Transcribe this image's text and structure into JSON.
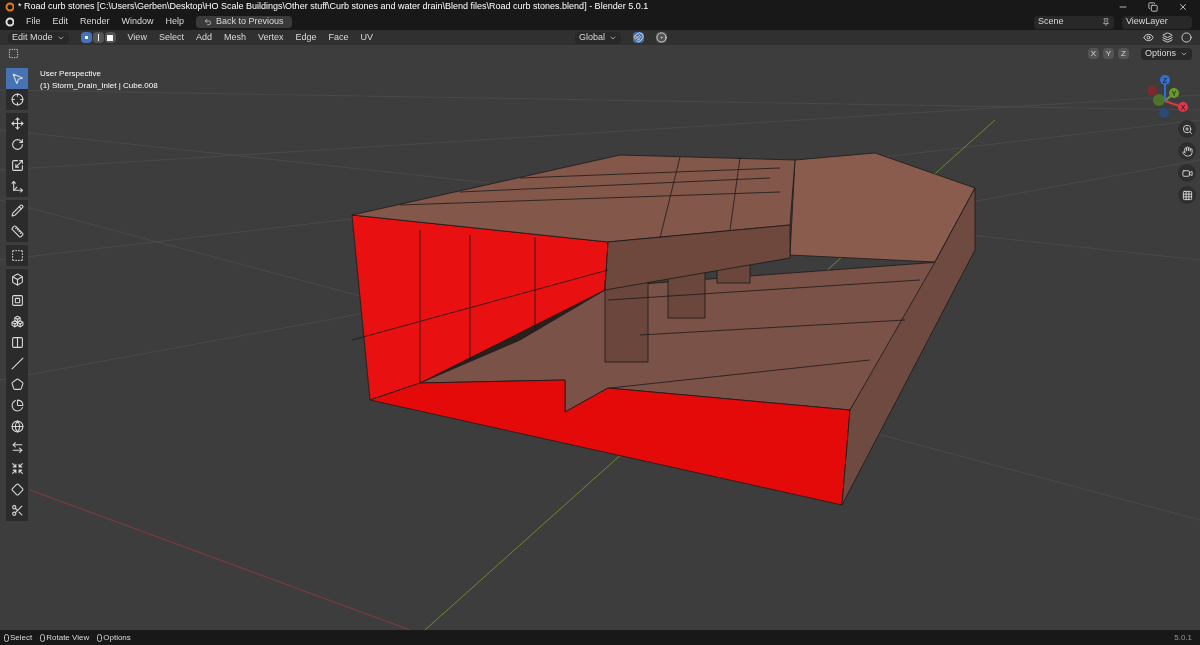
{
  "window": {
    "title": "* Road curb stones [C:\\Users\\Gerben\\Desktop\\HO Scale Buildings\\Other stuff\\Curb stones and water drain\\Blend files\\Road curb stones.blend] - Blender 5.0.1"
  },
  "menu_bar": {
    "items": [
      "File",
      "Edit",
      "Render",
      "Window",
      "Help"
    ],
    "back_button": "Back to Previous",
    "scene": "Scene",
    "view_layer": "ViewLayer"
  },
  "header": {
    "mode": "Edit Mode",
    "select_modes": [
      {
        "kind": "vertex",
        "selected": true
      },
      {
        "kind": "edge",
        "selected": false
      },
      {
        "kind": "face",
        "selected": false
      }
    ],
    "menus": [
      "View",
      "Select",
      "Add",
      "Mesh",
      "Vertex",
      "Edge",
      "Face",
      "UV"
    ],
    "orientation": "Global",
    "snap": {
      "on": true
    },
    "proportional": {
      "on": false
    }
  },
  "tool_settings": {
    "axes": [
      "X",
      "Y",
      "Z"
    ],
    "options": "Options"
  },
  "viewport": {
    "view_name": "User Perspective",
    "object_info": "(1) Storm_Drain_Inlet | Cube.008",
    "tool_groups": [
      [
        {
          "kind": "select",
          "selected": true
        },
        {
          "kind": "cursor",
          "selected": false
        }
      ],
      [
        {
          "kind": "move",
          "selected": false
        },
        {
          "kind": "rotate",
          "selected": false
        },
        {
          "kind": "scale",
          "selected": false
        },
        {
          "kind": "transform",
          "selected": false
        }
      ],
      [
        {
          "kind": "annotate",
          "selected": false
        },
        {
          "kind": "measure",
          "selected": false
        }
      ],
      [
        {
          "kind": "add",
          "selected": false
        }
      ],
      [
        {
          "kind": "extrude",
          "selected": false
        },
        {
          "kind": "inset",
          "selected": false
        },
        {
          "kind": "bevel",
          "selected": false
        },
        {
          "kind": "loop",
          "selected": false
        },
        {
          "kind": "knife",
          "selected": false
        },
        {
          "kind": "poly",
          "selected": false
        },
        {
          "kind": "spin",
          "selected": false
        },
        {
          "kind": "smooth",
          "selected": false
        },
        {
          "kind": "slide",
          "selected": false
        },
        {
          "kind": "shrink",
          "selected": false
        },
        {
          "kind": "shear",
          "selected": false
        },
        {
          "kind": "rip",
          "selected": false
        }
      ]
    ],
    "gizmo": [
      {
        "label": "Z",
        "color": "#2f6fd6"
      },
      {
        "label": "Y",
        "color": "#6a9a2e"
      },
      {
        "label": "X",
        "color": "#e0364a"
      }
    ]
  },
  "status_bar": {
    "hints": [
      "Select",
      "Rotate View",
      "Options"
    ],
    "version": "5.0.1"
  }
}
